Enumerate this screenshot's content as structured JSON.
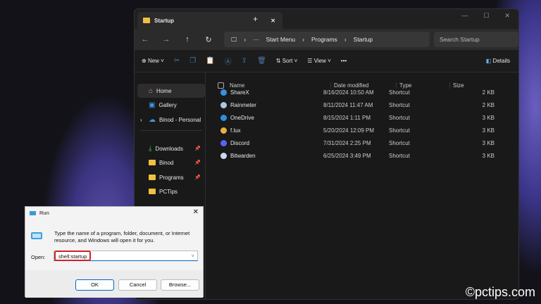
{
  "explorer": {
    "tab_title": "Startup",
    "new_tab": "+",
    "breadcrumb": [
      "Start Menu",
      "Programs",
      "Startup"
    ],
    "search_placeholder": "Search Startup",
    "toolbar": {
      "new": "New",
      "sort": "Sort",
      "view": "View",
      "more": "•••",
      "details": "Details"
    },
    "sidebar": [
      {
        "label": "Home",
        "icon": "home-icon",
        "pinned": false
      },
      {
        "label": "Gallery",
        "icon": "gallery-icon",
        "pinned": false
      },
      {
        "label": "Binod - Personal",
        "icon": "cloud-icon",
        "pinned": false
      },
      {
        "label": "Downloads",
        "icon": "download-icon",
        "pinned": true
      },
      {
        "label": "Binod",
        "icon": "folder-icon",
        "pinned": true
      },
      {
        "label": "Programs",
        "icon": "folder-icon",
        "pinned": true
      },
      {
        "label": "PCTips",
        "icon": "folder-icon",
        "pinned": false
      }
    ],
    "columns": [
      "Name",
      "Date modified",
      "Type",
      "Size"
    ],
    "files": [
      {
        "name": "ShareX",
        "date": "8/16/2024 10:50 AM",
        "type": "Shortcut",
        "size": "2 KB",
        "color": "#3a8ee6"
      },
      {
        "name": "Rainmeter",
        "date": "8/11/2024 11:47 AM",
        "type": "Shortcut",
        "size": "2 KB",
        "color": "#a8c8e8"
      },
      {
        "name": "OneDrive",
        "date": "8/15/2024 1:11 PM",
        "type": "Shortcut",
        "size": "3 KB",
        "color": "#2f8ee0"
      },
      {
        "name": "f.lux",
        "date": "5/20/2024 12:09 PM",
        "type": "Shortcut",
        "size": "3 KB",
        "color": "#e8b040"
      },
      {
        "name": "Discord",
        "date": "7/31/2024 2:25 PM",
        "type": "Shortcut",
        "size": "3 KB",
        "color": "#5865f2"
      },
      {
        "name": "Bitwarden",
        "date": "6/25/2024 3:49 PM",
        "type": "Shortcut",
        "size": "3 KB",
        "color": "#cfd8e8"
      }
    ]
  },
  "run": {
    "title": "Run",
    "description": "Type the name of a program, folder, document, or Internet resource, and Windows will open it for you.",
    "open_label": "Open:",
    "value": "shell:startup",
    "ok": "OK",
    "cancel": "Cancel",
    "browse": "Browse..."
  },
  "watermark": "©pctips.com"
}
